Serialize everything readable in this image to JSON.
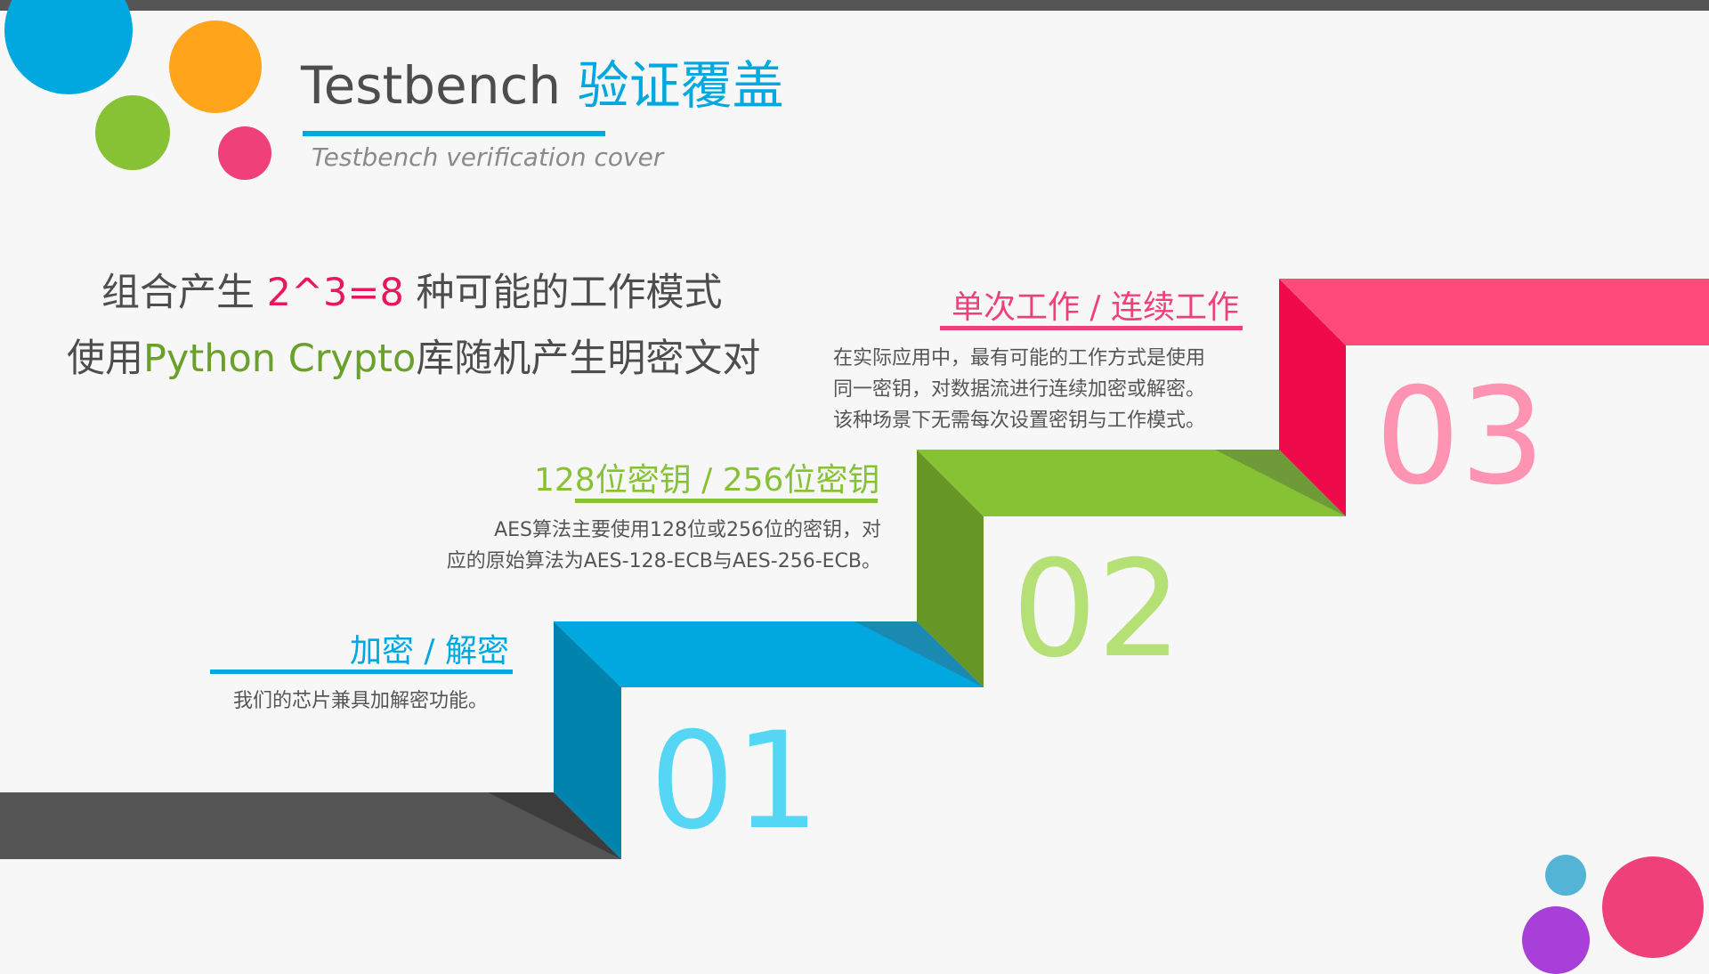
{
  "title": {
    "main": "Testbench",
    "accent": "验证覆盖",
    "subtitle": "Testbench  verification cover"
  },
  "intro": {
    "line1_prefix": "组合产生",
    "line1_highlight": "2^3=8",
    "line1_suffix": "种可能的工作模式",
    "line2_prefix": "使用",
    "line2_highlight": "Python Crypto",
    "line2_suffix": "库随机产生明密文对"
  },
  "steps": [
    {
      "number": "01",
      "heading": "加密 / 解密",
      "desc": "我们的芯片兼具加解密功能。",
      "color": "#00a8e0"
    },
    {
      "number": "02",
      "heading": "128位密钥 / 256位密钥",
      "desc_line1": "AES算法主要使用128位或256位的密钥，对",
      "desc_line2": "应的原始算法为AES-128-ECB与AES-256-ECB。",
      "color": "#86c233"
    },
    {
      "number": "03",
      "heading": "单次工作 / 连续工作",
      "desc_line1": "在实际应用中，最有可能的工作方式是使用",
      "desc_line2": "同一密钥，对数据流进行连续加密或解密。",
      "desc_line3": "该种场景下无需每次设置密钥与工作模式。",
      "color": "#f0407a"
    }
  ],
  "colors": {
    "blue": "#00a8e0",
    "green": "#86c233",
    "pink": "#f0407a",
    "orange": "#ffa41b",
    "gray": "#555555",
    "purple": "#a83fd8"
  }
}
